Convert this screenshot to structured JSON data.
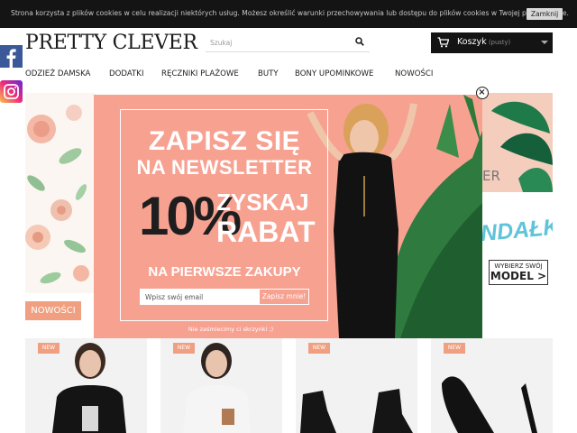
{
  "cookie_bar": {
    "text": "Strona korzysta z plików cookies w celu realizacji niektórych usług. Możesz określić warunki przechowywania lub dostępu do plików cookies w Twojej przeglądarce.",
    "close_label": "Zamknij"
  },
  "header": {
    "logo": "PRETTY CLEVER",
    "search_placeholder": "Szukaj",
    "cart_label": "Koszyk",
    "cart_status": "(pusty)"
  },
  "nav": {
    "items": [
      "ODZIEŻ DAMSKA",
      "DODATKI",
      "RĘCZNIKI PLAŻOWE",
      "BUTY",
      "BONY UPOMINKOWE",
      "NOWOŚCI"
    ]
  },
  "hero": {
    "text_er": "ER",
    "text_sandalki": "NDAŁKI",
    "model_line1": "WYBIERZ SWÓJ",
    "model_line2": "MODEL >",
    "badge": "NOWOŚCI"
  },
  "products": {
    "badge": "NEW"
  },
  "popup": {
    "title_line1": "ZAPISZ SIĘ",
    "title_line2": "NA NEWSLETTER",
    "discount": "10%",
    "zyskaj": "ZYSKAJ",
    "rabat": "RABAT",
    "subtitle": "NA PIERWSZE ZAKUPY",
    "email_placeholder": "Wpisz swój email",
    "submit_label": "Zapisz mnie!",
    "footer": "Nie zaśmiecimy ci skrzynki ;)",
    "close_symbol": "×"
  },
  "colors": {
    "popup_bg": "#f7a191",
    "accent": "#f0a080",
    "dark": "#141414"
  },
  "icons": [
    "search-icon",
    "cart-icon",
    "facebook-icon",
    "instagram-icon",
    "close-icon"
  ]
}
